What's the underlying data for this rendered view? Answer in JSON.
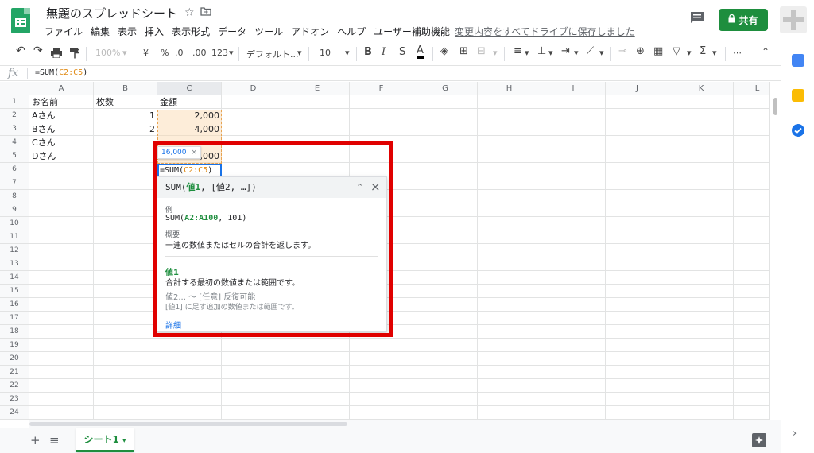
{
  "app": {
    "title": "無題のスプレッドシート",
    "menu": [
      "ファイル",
      "編集",
      "表示",
      "挿入",
      "表示形式",
      "データ",
      "ツール",
      "アドオン",
      "ヘルプ",
      "ユーザー補助機能"
    ],
    "save_status": "変更内容をすべてドライブに保存しました",
    "share_label": "共有",
    "brand_color": "#1e8e3e"
  },
  "toolbar": {
    "zoom": "100%",
    "currency": "¥",
    "percent": "%",
    "dec_decrease": ".0",
    "dec_increase": ".00",
    "format_more": "123",
    "font": "デフォルト...",
    "font_size": "10",
    "bold": "B",
    "italic": "I",
    "strike": "S",
    "text_color": "A",
    "more": "⋯"
  },
  "formula_bar": {
    "fx": "fx",
    "prefix": "=SUM(",
    "range": "C2:C5",
    "suffix": ")"
  },
  "grid": {
    "columns": [
      "A",
      "B",
      "C",
      "D",
      "E",
      "F",
      "G",
      "H",
      "I",
      "J",
      "K",
      "L"
    ],
    "rows": [
      "1",
      "2",
      "3",
      "4",
      "5",
      "6",
      "7",
      "8",
      "9",
      "10",
      "11",
      "12",
      "13",
      "14",
      "15",
      "16",
      "17",
      "18",
      "19",
      "20",
      "21",
      "22",
      "23",
      "24"
    ],
    "cells": {
      "A1": "お名前",
      "B1": "枚数",
      "C1": "金額",
      "A2": "Aさん",
      "B2": "1",
      "C2": "2,000",
      "A3": "Bさん",
      "B3": "2",
      "C3": "4,000",
      "A4": "Cさん",
      "A5": "Dさん",
      "C5": "8,000"
    },
    "active_cell": {
      "prefix": "=SUM(",
      "range": "C2:C5",
      "suffix": ")"
    },
    "result_chip": "16,000",
    "result_chip_close": "×"
  },
  "help": {
    "signature_name": "SUM(",
    "signature_arg1": "値1",
    "signature_rest": ", [値2, …])",
    "example_label": "例",
    "example_prefix": "SUM(",
    "example_range": "A2:A100",
    "example_suffix": ", 101)",
    "summary_label": "概要",
    "summary": "一連の数値またはセルの合計を返します。",
    "arg1_name": "値1",
    "arg1_desc": "合計する最初の数値または範囲です。",
    "arg2_name": "値2... ～ [任意] 反復可能",
    "arg2_desc": "[値1] に足す追加の数値または範囲です。",
    "more_link": "詳細"
  },
  "sheets": {
    "add": "+",
    "list": "≡",
    "active": "シート1"
  }
}
